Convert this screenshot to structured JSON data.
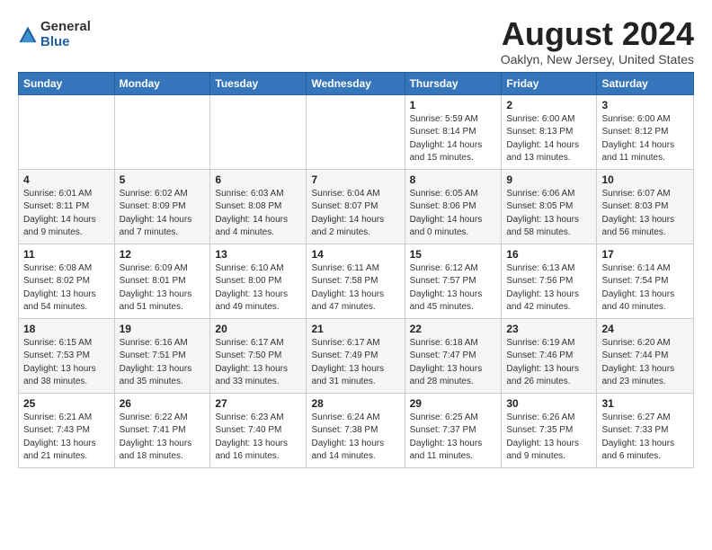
{
  "logo": {
    "general": "General",
    "blue": "Blue"
  },
  "header": {
    "month": "August 2024",
    "location": "Oaklyn, New Jersey, United States"
  },
  "days_of_week": [
    "Sunday",
    "Monday",
    "Tuesday",
    "Wednesday",
    "Thursday",
    "Friday",
    "Saturday"
  ],
  "weeks": [
    [
      {
        "day": "",
        "info": ""
      },
      {
        "day": "",
        "info": ""
      },
      {
        "day": "",
        "info": ""
      },
      {
        "day": "",
        "info": ""
      },
      {
        "day": "1",
        "info": "Sunrise: 5:59 AM\nSunset: 8:14 PM\nDaylight: 14 hours\nand 15 minutes."
      },
      {
        "day": "2",
        "info": "Sunrise: 6:00 AM\nSunset: 8:13 PM\nDaylight: 14 hours\nand 13 minutes."
      },
      {
        "day": "3",
        "info": "Sunrise: 6:00 AM\nSunset: 8:12 PM\nDaylight: 14 hours\nand 11 minutes."
      }
    ],
    [
      {
        "day": "4",
        "info": "Sunrise: 6:01 AM\nSunset: 8:11 PM\nDaylight: 14 hours\nand 9 minutes."
      },
      {
        "day": "5",
        "info": "Sunrise: 6:02 AM\nSunset: 8:09 PM\nDaylight: 14 hours\nand 7 minutes."
      },
      {
        "day": "6",
        "info": "Sunrise: 6:03 AM\nSunset: 8:08 PM\nDaylight: 14 hours\nand 4 minutes."
      },
      {
        "day": "7",
        "info": "Sunrise: 6:04 AM\nSunset: 8:07 PM\nDaylight: 14 hours\nand 2 minutes."
      },
      {
        "day": "8",
        "info": "Sunrise: 6:05 AM\nSunset: 8:06 PM\nDaylight: 14 hours\nand 0 minutes."
      },
      {
        "day": "9",
        "info": "Sunrise: 6:06 AM\nSunset: 8:05 PM\nDaylight: 13 hours\nand 58 minutes."
      },
      {
        "day": "10",
        "info": "Sunrise: 6:07 AM\nSunset: 8:03 PM\nDaylight: 13 hours\nand 56 minutes."
      }
    ],
    [
      {
        "day": "11",
        "info": "Sunrise: 6:08 AM\nSunset: 8:02 PM\nDaylight: 13 hours\nand 54 minutes."
      },
      {
        "day": "12",
        "info": "Sunrise: 6:09 AM\nSunset: 8:01 PM\nDaylight: 13 hours\nand 51 minutes."
      },
      {
        "day": "13",
        "info": "Sunrise: 6:10 AM\nSunset: 8:00 PM\nDaylight: 13 hours\nand 49 minutes."
      },
      {
        "day": "14",
        "info": "Sunrise: 6:11 AM\nSunset: 7:58 PM\nDaylight: 13 hours\nand 47 minutes."
      },
      {
        "day": "15",
        "info": "Sunrise: 6:12 AM\nSunset: 7:57 PM\nDaylight: 13 hours\nand 45 minutes."
      },
      {
        "day": "16",
        "info": "Sunrise: 6:13 AM\nSunset: 7:56 PM\nDaylight: 13 hours\nand 42 minutes."
      },
      {
        "day": "17",
        "info": "Sunrise: 6:14 AM\nSunset: 7:54 PM\nDaylight: 13 hours\nand 40 minutes."
      }
    ],
    [
      {
        "day": "18",
        "info": "Sunrise: 6:15 AM\nSunset: 7:53 PM\nDaylight: 13 hours\nand 38 minutes."
      },
      {
        "day": "19",
        "info": "Sunrise: 6:16 AM\nSunset: 7:51 PM\nDaylight: 13 hours\nand 35 minutes."
      },
      {
        "day": "20",
        "info": "Sunrise: 6:17 AM\nSunset: 7:50 PM\nDaylight: 13 hours\nand 33 minutes."
      },
      {
        "day": "21",
        "info": "Sunrise: 6:17 AM\nSunset: 7:49 PM\nDaylight: 13 hours\nand 31 minutes."
      },
      {
        "day": "22",
        "info": "Sunrise: 6:18 AM\nSunset: 7:47 PM\nDaylight: 13 hours\nand 28 minutes."
      },
      {
        "day": "23",
        "info": "Sunrise: 6:19 AM\nSunset: 7:46 PM\nDaylight: 13 hours\nand 26 minutes."
      },
      {
        "day": "24",
        "info": "Sunrise: 6:20 AM\nSunset: 7:44 PM\nDaylight: 13 hours\nand 23 minutes."
      }
    ],
    [
      {
        "day": "25",
        "info": "Sunrise: 6:21 AM\nSunset: 7:43 PM\nDaylight: 13 hours\nand 21 minutes."
      },
      {
        "day": "26",
        "info": "Sunrise: 6:22 AM\nSunset: 7:41 PM\nDaylight: 13 hours\nand 18 minutes."
      },
      {
        "day": "27",
        "info": "Sunrise: 6:23 AM\nSunset: 7:40 PM\nDaylight: 13 hours\nand 16 minutes."
      },
      {
        "day": "28",
        "info": "Sunrise: 6:24 AM\nSunset: 7:38 PM\nDaylight: 13 hours\nand 14 minutes."
      },
      {
        "day": "29",
        "info": "Sunrise: 6:25 AM\nSunset: 7:37 PM\nDaylight: 13 hours\nand 11 minutes."
      },
      {
        "day": "30",
        "info": "Sunrise: 6:26 AM\nSunset: 7:35 PM\nDaylight: 13 hours\nand 9 minutes."
      },
      {
        "day": "31",
        "info": "Sunrise: 6:27 AM\nSunset: 7:33 PM\nDaylight: 13 hours\nand 6 minutes."
      }
    ]
  ]
}
